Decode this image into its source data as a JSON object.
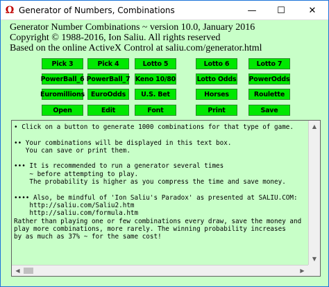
{
  "window": {
    "title": "Generator of Numbers, Combinations",
    "icon": "omega-icon",
    "controls": {
      "minimize": "—",
      "maximize": "☐",
      "close": "✕"
    }
  },
  "header": {
    "line1": "Generator Number Combinations ~ version 10.0, January 2016",
    "line2": "Copyright © 1988-2016, Ion Saliu. All rights reserved",
    "line3": "Based on the online ActiveX Control at saliu.com/generator.html"
  },
  "buttons": {
    "row1": [
      "Pick 3",
      "Pick 4",
      "Lotto 5",
      "Lotto 6",
      "Lotto 7"
    ],
    "row2": [
      "PowerBall_6",
      "PowerBall_7",
      "Keno 10/80",
      "Lotto Odds",
      "PowerOdds"
    ],
    "row3": [
      "Euromillions",
      "EuroOdds",
      "U.S. Bet",
      "Horses",
      "Roulette"
    ],
    "row4": [
      "Open",
      "Edit",
      "Font",
      "Print",
      "Save"
    ]
  },
  "textbox": {
    "content": "• Click on a button to generate 1000 combinations for that type of game.\n\n•• Your combinations will be displayed in this text box.\n   You can save or print them.\n\n••• It is recommended to run a generator several times\n    ~ before attempting to play.\n    The probability is higher as you compress the time and save money.\n\n•••• Also, be mindful of 'Ion Saliu's Paradox' as presented at SALIU.COM:\n    http://saliu.com/Saliu2.htm\n    http://saliu.com/formula.htm\nRather than playing one or few combinations every draw, save the money and\nplay more combinations, more rarely. The winning probability increases\nby as much as 37% ~ for the same cost!",
    "scroll_up": "▲",
    "scroll_down": "▼",
    "scroll_left": "◀",
    "scroll_right": "▶"
  },
  "colors": {
    "background": "#c8ffc8",
    "button": "#00e800",
    "window_border": "#1a73d9"
  }
}
